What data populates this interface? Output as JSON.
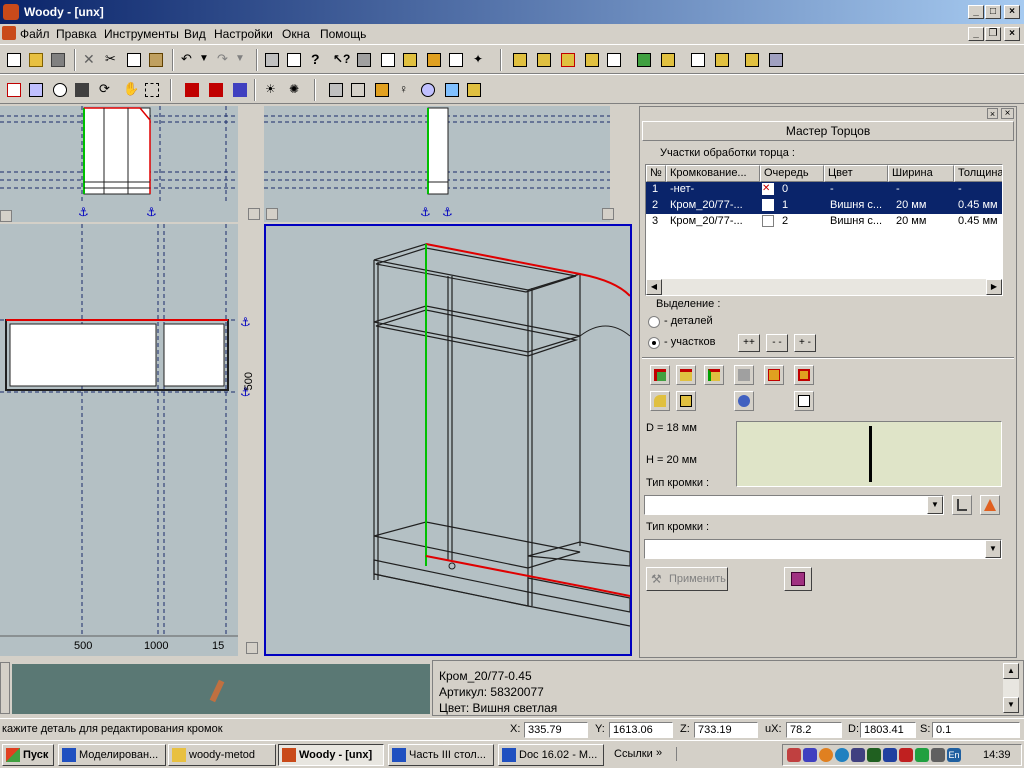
{
  "window": {
    "title": "Woody - [unx]",
    "min": "_",
    "restore": "□",
    "close": "×",
    "doc_min": "_",
    "doc_restore": "❐",
    "doc_close": "×"
  },
  "menu": [
    "Файл",
    "Правка",
    "Инструменты",
    "Вид",
    "Настройки",
    "Окна",
    "Помощь"
  ],
  "viewports": {
    "ruler_500_side": "500",
    "ruler_bottom": [
      "500",
      "1000",
      "15"
    ]
  },
  "panel": {
    "header": "Мастер Торцов",
    "section_label": "Участки обработки торца :",
    "columns": [
      "№",
      "Кромкование...",
      "Очередь",
      "Цвет",
      "Ширина",
      "Толщина"
    ],
    "rows": [
      {
        "n": "1",
        "edge": "-нет-",
        "queue": "0",
        "color": "-",
        "width": "-",
        "thickness": "-",
        "selected": true
      },
      {
        "n": "2",
        "edge": "Кром_20/77-...",
        "queue": "1",
        "color": "Вишня с...",
        "width": "20 мм",
        "thickness": "0.45 мм",
        "selected": true
      },
      {
        "n": "3",
        "edge": "Кром_20/77-...",
        "queue": "2",
        "color": "Вишня с...",
        "width": "20 мм",
        "thickness": "0.45 мм",
        "selected": false
      }
    ],
    "selection_label": "Выделение :",
    "radio_parts": "- деталей",
    "radio_areas": "- участков",
    "btn_plusplus": "++",
    "btn_minusminus": "- -",
    "btn_plusminus": "+ -",
    "d_label": "D =   18 мм",
    "h_label": "H =   20 мм",
    "edge_type_1": "Тип кромки :",
    "edge_type_2": "Тип кромки :",
    "apply": "Применить"
  },
  "info": {
    "line1": "Кром_20/77-0.45",
    "line2": "Артикул: 58320077",
    "line3": "Цвет: Вишня светлая"
  },
  "status": {
    "hint": "кажите деталь для редактирования кромок",
    "x_label": "X:",
    "x": "335.79",
    "y_label": "Y:",
    "y": "1613.06",
    "z_label": "Z:",
    "z": "733.19",
    "ux_label": "uX:",
    "ux": "78.2",
    "d_label": "D:",
    "d": "1803.41",
    "s_label": "S:",
    "s": "0.1"
  },
  "taskbar": {
    "start": "Пуск",
    "tasks": [
      "Моделирован...",
      "woody-metod",
      "Woody - [unx]",
      "Часть III стол...",
      "Doc 16.02 - М..."
    ],
    "links": "Ссылки",
    "links_arrow": "»",
    "lang": "En",
    "clock": "14:39"
  },
  "colors": {
    "selection": "#0a246a",
    "viewport_bg": "#b4c0c4",
    "accent_red": "#e00000",
    "accent_green": "#00c000",
    "accent_blue": "#0000c0"
  }
}
